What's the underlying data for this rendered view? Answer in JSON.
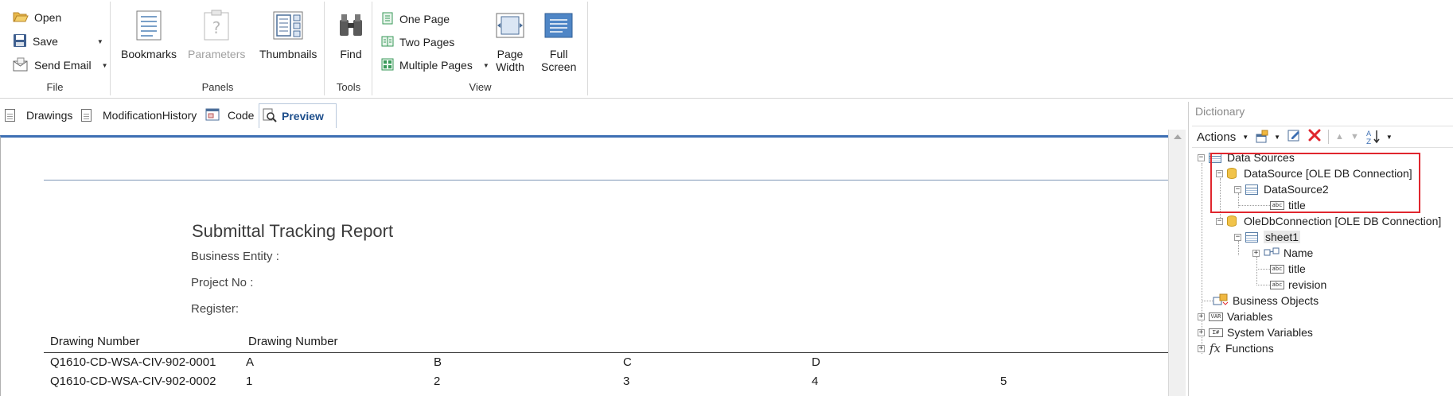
{
  "ribbon": {
    "file": {
      "label": "File",
      "open": "Open",
      "save": "Save",
      "send_email": "Send Email"
    },
    "panels": {
      "label": "Panels",
      "bookmarks": "Bookmarks",
      "parameters": "Parameters",
      "thumbnails": "Thumbnails"
    },
    "tools": {
      "label": "Tools",
      "find": "Find"
    },
    "view": {
      "label": "View",
      "one_page": "One Page",
      "two_pages": "Two Pages",
      "multiple_pages": "Multiple Pages",
      "page_width_1": "Page",
      "page_width_2": "Width",
      "full_screen_1": "Full",
      "full_screen_2": "Screen"
    }
  },
  "tabs": [
    {
      "label": "Drawings"
    },
    {
      "label": "ModificationHistory"
    },
    {
      "label": "Code"
    },
    {
      "label": "Preview"
    }
  ],
  "report": {
    "title": "Submittal Tracking Report",
    "business_entity": "Business Entity :",
    "project_no": "Project No :",
    "register": "Register:",
    "headers": [
      "Drawing Number",
      "Drawing Number"
    ],
    "rows": [
      [
        "Q1610-CD-WSA-CIV-902-0001",
        "A",
        "B",
        "C",
        "D",
        ""
      ],
      [
        "Q1610-CD-WSA-CIV-902-0002",
        "1",
        "2",
        "3",
        "4",
        "5"
      ]
    ]
  },
  "dictionary": {
    "title": "Dictionary",
    "actions": "Actions",
    "tree": {
      "data_sources": "Data Sources",
      "datasource": "DataSource [OLE DB Connection]",
      "datasource2": "DataSource2",
      "title_1": "title",
      "oledb": "OleDbConnection [OLE DB Connection]",
      "sheet1": "sheet1",
      "name": "Name",
      "title_2": "title",
      "revision": "revision",
      "business_objects": "Business Objects",
      "variables": "Variables",
      "system_variables": "System Variables",
      "functions": "Functions"
    }
  },
  "colors": {
    "accent": "#3d6fb3",
    "highlight": "#e0262e"
  }
}
